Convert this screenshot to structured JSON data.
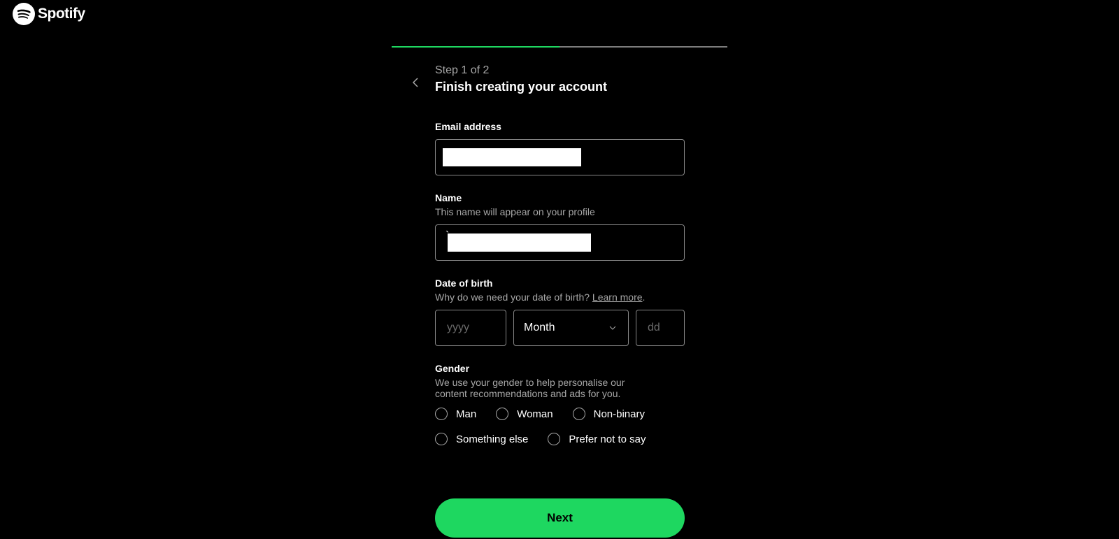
{
  "brand": "Spotify",
  "progress": {
    "step_label": "Step 1 of 2",
    "title": "Finish creating your account"
  },
  "email": {
    "label": "Email address",
    "value": ""
  },
  "name": {
    "label": "Name",
    "hint": "This name will appear on your profile",
    "value": ""
  },
  "dob": {
    "label": "Date of birth",
    "hint_prefix": "Why do we need your date of birth? ",
    "learn_more": "Learn more",
    "year_placeholder": "yyyy",
    "month_placeholder": "Month",
    "day_placeholder": "dd"
  },
  "gender": {
    "label": "Gender",
    "hint": "We use your gender to help personalise our content recommendations and ads for you.",
    "options": [
      "Man",
      "Woman",
      "Non-binary",
      "Something else",
      "Prefer not to say"
    ]
  },
  "next": "Next"
}
